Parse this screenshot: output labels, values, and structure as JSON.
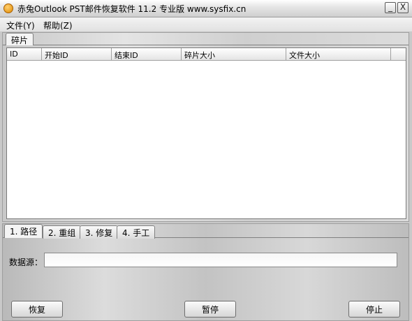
{
  "window": {
    "title": "赤兔Outlook PST邮件恢复软件 11.2 专业版 www.sysfix.cn",
    "minimize_glyph": "_",
    "close_glyph": "X"
  },
  "menu": [
    {
      "label": "文件(Y)"
    },
    {
      "label": "帮助(Z)"
    }
  ],
  "top_tabs": [
    {
      "label": "碎片"
    }
  ],
  "table": {
    "columns": [
      "ID",
      "开始ID",
      "结束ID",
      "碎片大小",
      "文件大小"
    ],
    "rows": []
  },
  "bottom_tabs": [
    {
      "label": "1. 路径"
    },
    {
      "label": "2. 重组"
    },
    {
      "label": "3. 修复"
    },
    {
      "label": "4. 手工"
    }
  ],
  "source": {
    "label": "数据源：",
    "value": ""
  },
  "buttons": {
    "recover": "恢复",
    "pause": "暂停",
    "stop": "停止"
  }
}
